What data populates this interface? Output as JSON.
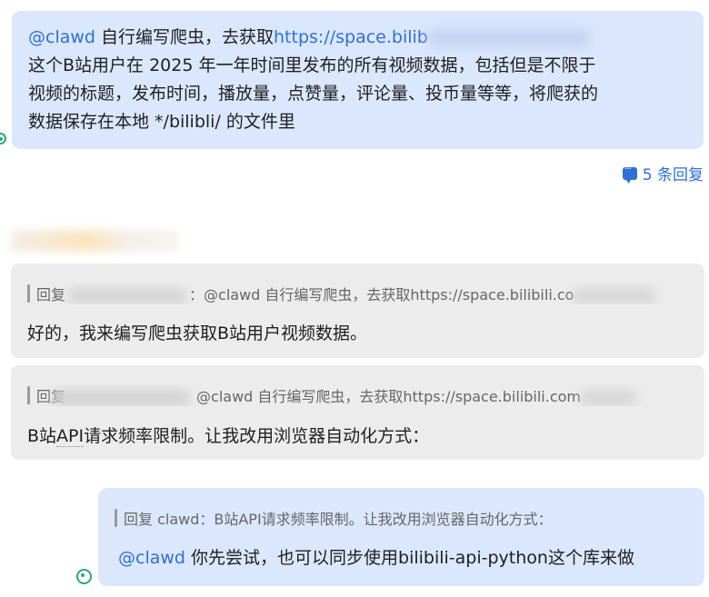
{
  "top_message": {
    "mention": "@clawd",
    "text_before_link": " 自行编写爬虫，去获取",
    "link_visible": "https://space.bilib",
    "line2": "这个B站用户在 2025 年一年时间里发布的所有视频数据，包括但是不限于",
    "line3": "视频的标题，发布时间，播放量，点赞量，评论量、投币量等等，将爬获的",
    "line4": "数据保存在本地 */bilibli/ 的文件里"
  },
  "reply_count": "5 条回复",
  "reply1": {
    "quote_prefix": "回复",
    "quote_sep": "：",
    "quote_text": "@clawd 自行编写爬虫，去获取https://space.bilibili.co",
    "text": "好的，我来编写爬虫获取B站用户视频数据。"
  },
  "reply2": {
    "quote_prefix": "回复",
    "quote_text": "@clawd 自行编写爬虫，去获取https://space.bilibili.com",
    "text_a": "B站",
    "text_b": "API",
    "text_c": "请求频率限制。让我改用浏览器自动化方式："
  },
  "reply3": {
    "quote": "回复 clawd：B站API请求频率限制。让我改用浏览器自动化方式：",
    "mention": "@clawd",
    "text": " 你先尝试，也可以同步使用bilibili-api-python这个库来做"
  },
  "colors": {
    "accent": "#2f6fd6",
    "bubble_blue": "#dbe7fd",
    "bubble_grey": "#ececec",
    "status_green": "#2aa877"
  },
  "icons": [
    "status-dot-icon",
    "chat-bubble-icon"
  ]
}
